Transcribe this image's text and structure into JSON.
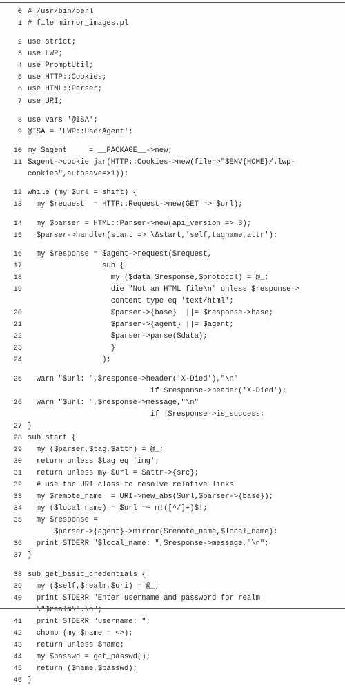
{
  "document": {
    "kind": "code-listing",
    "language": "perl",
    "title": "mirror_images.pl",
    "colors": {
      "page_background": "#fdfdfd",
      "text": "#2a2a2c",
      "rule": "#59595b"
    }
  },
  "listing": {
    "rows": [
      {
        "type": "code",
        "num": "0",
        "text": "#!/usr/bin/perl"
      },
      {
        "type": "code",
        "num": "1",
        "text": "# file mirror_images.pl"
      },
      {
        "type": "gap"
      },
      {
        "type": "code",
        "num": "2",
        "text": "use strict;"
      },
      {
        "type": "code",
        "num": "3",
        "text": "use LWP;"
      },
      {
        "type": "code",
        "num": "4",
        "text": "use PromptUtil;"
      },
      {
        "type": "code",
        "num": "5",
        "text": "use HTTP::Cookies;"
      },
      {
        "type": "code",
        "num": "6",
        "text": "use HTML::Parser;"
      },
      {
        "type": "code",
        "num": "7",
        "text": "use URI;"
      },
      {
        "type": "gap"
      },
      {
        "type": "code",
        "num": "8",
        "text": "use vars '@ISA';"
      },
      {
        "type": "code",
        "num": "9",
        "text": "@ISA = 'LWP::UserAgent';"
      },
      {
        "type": "gap"
      },
      {
        "type": "code",
        "num": "10",
        "text": "my $agent     = __PACKAGE__->new;"
      },
      {
        "type": "code",
        "num": "11",
        "text": "$agent->cookie_jar(HTTP::Cookies->new(file=>\"$ENV{HOME}/.lwp-"
      },
      {
        "type": "code",
        "num": "",
        "text": "cookies\",autosave=>1));"
      },
      {
        "type": "gap"
      },
      {
        "type": "code",
        "num": "12",
        "text": "while (my $url = shift) {"
      },
      {
        "type": "code",
        "num": "13",
        "text": "  my $request  = HTTP::Request->new(GET => $url);"
      },
      {
        "type": "gap"
      },
      {
        "type": "code",
        "num": "14",
        "text": "  my $parser = HTML::Parser->new(api_version => 3);"
      },
      {
        "type": "code",
        "num": "15",
        "text": "  $parser->handler(start => \\&start,'self,tagname,attr');"
      },
      {
        "type": "gap"
      },
      {
        "type": "code",
        "num": "16",
        "text": "  my $response = $agent->request($request,"
      },
      {
        "type": "code",
        "num": "17",
        "text": "                 sub {"
      },
      {
        "type": "code",
        "num": "18",
        "text": "                   my ($data,$response,$protocol) = @_;"
      },
      {
        "type": "code",
        "num": "19",
        "text": "                   die \"Not an HTML file\\n\" unless $response->"
      },
      {
        "type": "code",
        "num": "",
        "text": "                   content_type eq 'text/html';"
      },
      {
        "type": "code",
        "num": "20",
        "text": "                   $parser->{base}  ||= $response->base;"
      },
      {
        "type": "code",
        "num": "21",
        "text": "                   $parser->{agent} ||= $agent;"
      },
      {
        "type": "code",
        "num": "22",
        "text": "                   $parser->parse($data);"
      },
      {
        "type": "code",
        "num": "23",
        "text": "                   }"
      },
      {
        "type": "code",
        "num": "24",
        "text": "                 );"
      },
      {
        "type": "gap"
      },
      {
        "type": "code",
        "num": "25",
        "text": "  warn \"$url: \",$response->header('X-Died'),\"\\n\""
      },
      {
        "type": "code",
        "num": "",
        "text": "                            if $response->header('X-Died');"
      },
      {
        "type": "code",
        "num": "26",
        "text": "  warn \"$url: \",$response->message,\"\\n\""
      },
      {
        "type": "code",
        "num": "",
        "text": "                            if !$response->is_success;"
      },
      {
        "type": "code",
        "num": "27",
        "text": "}"
      },
      {
        "type": "code",
        "num": "28",
        "text": "sub start {"
      },
      {
        "type": "code",
        "num": "29",
        "text": "  my ($parser,$tag,$attr) = @_;"
      },
      {
        "type": "code",
        "num": "30",
        "text": "  return unless $tag eq 'img';"
      },
      {
        "type": "code",
        "num": "31",
        "text": "  return unless my $url = $attr->{src};"
      },
      {
        "type": "code",
        "num": "32",
        "text": "  # use the URI class to resolve relative links"
      },
      {
        "type": "code",
        "num": "33",
        "text": "  my $remote_name  = URI->new_abs($url,$parser->{base});"
      },
      {
        "type": "code",
        "num": "34",
        "text": "  my ($local_name) = $url =~ m!([^/]+)$!;"
      },
      {
        "type": "code",
        "num": "35",
        "text": "  my $response ="
      },
      {
        "type": "code",
        "num": "",
        "text": "      $parser->{agent}->mirror($remote_name,$local_name);"
      },
      {
        "type": "code",
        "num": "36",
        "text": "  print STDERR \"$local_name: \",$response->message,\"\\n\";"
      },
      {
        "type": "code",
        "num": "37",
        "text": "}"
      },
      {
        "type": "gap"
      },
      {
        "type": "code",
        "num": "38",
        "text": "sub get_basic_credentials {"
      },
      {
        "type": "code",
        "num": "39",
        "text": "  my ($self,$realm,$uri) = @_;"
      },
      {
        "type": "code",
        "num": "40",
        "text": "  print STDERR \"Enter username and password for realm"
      },
      {
        "type": "code",
        "num": "",
        "text": "  \\\"$realm\\\".\\n\";"
      },
      {
        "type": "code",
        "num": "41",
        "text": "  print STDERR \"username: \";"
      },
      {
        "type": "code",
        "num": "42",
        "text": "  chomp (my $name = <>);"
      },
      {
        "type": "code",
        "num": "43",
        "text": "  return unless $name;"
      },
      {
        "type": "code",
        "num": "44",
        "text": "  my $passwd = get_passwd();"
      },
      {
        "type": "code",
        "num": "45",
        "text": "  return ($name,$passwd);"
      },
      {
        "type": "code",
        "num": "46",
        "text": "}"
      }
    ]
  }
}
